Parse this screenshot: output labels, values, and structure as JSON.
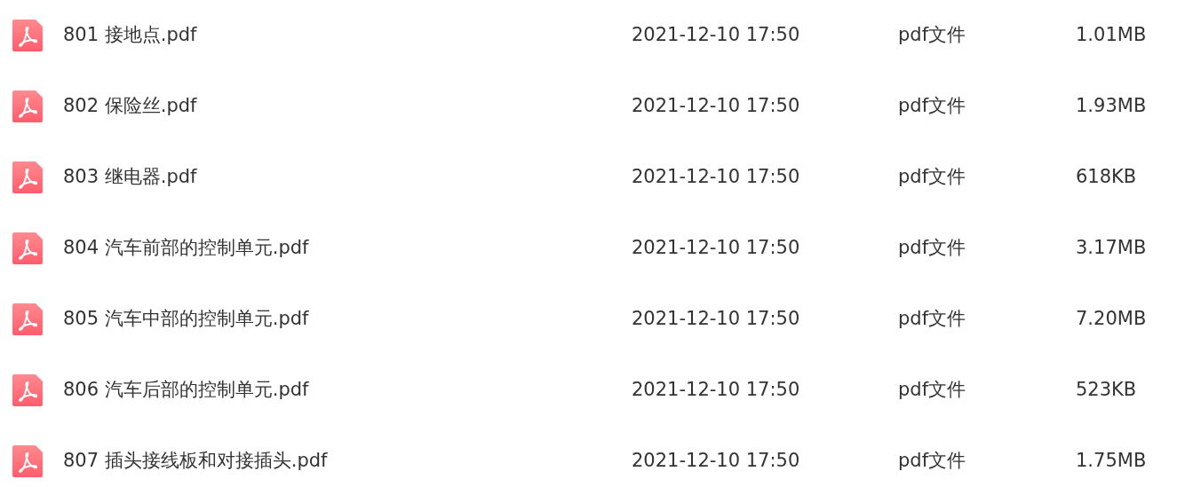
{
  "files": [
    {
      "name": "801 接地点.pdf",
      "modified": "2021-12-10 17:50",
      "type": "pdf文件",
      "size": "1.01MB"
    },
    {
      "name": "802 保险丝.pdf",
      "modified": "2021-12-10 17:50",
      "type": "pdf文件",
      "size": "1.93MB"
    },
    {
      "name": "803 继电器.pdf",
      "modified": "2021-12-10 17:50",
      "type": "pdf文件",
      "size": "618KB"
    },
    {
      "name": "804 汽车前部的控制单元.pdf",
      "modified": "2021-12-10 17:50",
      "type": "pdf文件",
      "size": "3.17MB"
    },
    {
      "name": "805 汽车中部的控制单元.pdf",
      "modified": "2021-12-10 17:50",
      "type": "pdf文件",
      "size": "7.20MB"
    },
    {
      "name": "806 汽车后部的控制单元.pdf",
      "modified": "2021-12-10 17:50",
      "type": "pdf文件",
      "size": "523KB"
    },
    {
      "name": "807 插头接线板和对接插头.pdf",
      "modified": "2021-12-10 17:50",
      "type": "pdf文件",
      "size": "1.75MB"
    }
  ]
}
